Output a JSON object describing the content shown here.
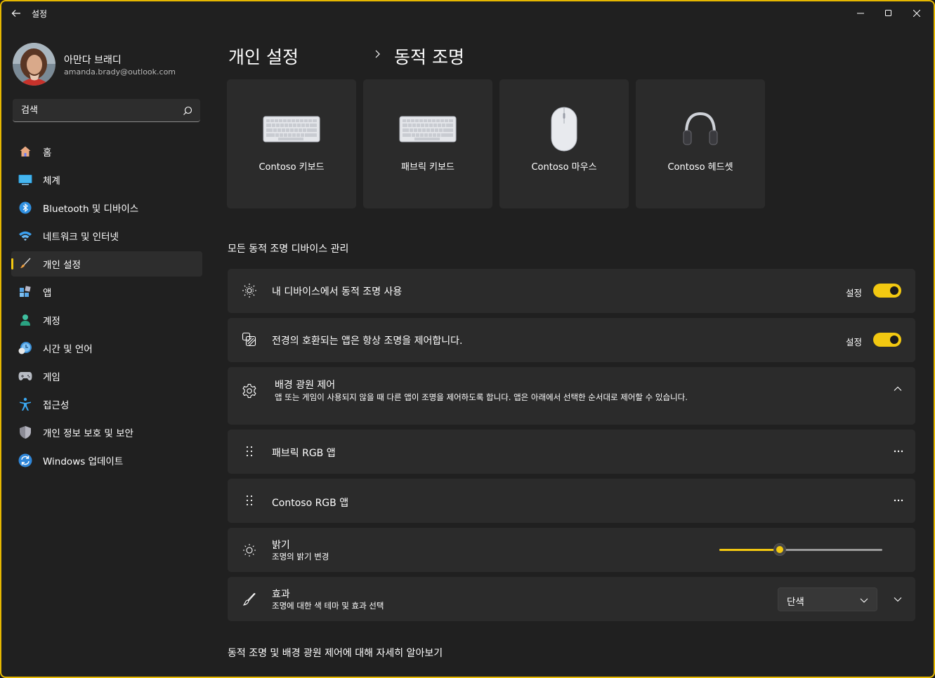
{
  "window": {
    "title": "설정",
    "border_color": "#e6b800"
  },
  "profile": {
    "name": "아만다 브래디",
    "email": "amanda.brady@outlook.com"
  },
  "search": {
    "placeholder": "검색"
  },
  "nav": {
    "items": [
      {
        "label": "홈",
        "icon": "home-icon"
      },
      {
        "label": "체계",
        "icon": "system-icon"
      },
      {
        "label": "Bluetooth 및 디바이스",
        "icon": "bluetooth-icon"
      },
      {
        "label": "네트워크 및 인터넷",
        "icon": "wifi-icon"
      },
      {
        "label": "개인 설정",
        "icon": "brush-icon",
        "active": true
      },
      {
        "label": "앱",
        "icon": "apps-icon"
      },
      {
        "label": "계정",
        "icon": "account-icon"
      },
      {
        "label": "시간 및 언어",
        "icon": "time-language-icon"
      },
      {
        "label": "게임",
        "icon": "gamepad-icon"
      },
      {
        "label": "접근성",
        "icon": "accessibility-icon"
      },
      {
        "label": "개인 정보 보호 및 보안",
        "icon": "shield-icon"
      },
      {
        "label": "Windows 업데이트",
        "icon": "update-icon"
      }
    ]
  },
  "breadcrumb": {
    "parent": "개인 설정",
    "current": "동적 조명"
  },
  "devices": [
    {
      "label": "Contoso 키보드",
      "icon": "keyboard-icon"
    },
    {
      "label": "패브릭 키보드",
      "icon": "keyboard-icon"
    },
    {
      "label": "Contoso 마우스",
      "icon": "mouse-icon"
    },
    {
      "label": "Contoso 헤드셋",
      "icon": "headset-icon"
    }
  ],
  "manage": {
    "section_title": "모든 동적 조명 디바이스 관리",
    "use_dynamic_lighting": {
      "title": "내 디바이스에서 동적 조명 사용",
      "toggle_label": "설정",
      "on": true
    },
    "foreground_control": {
      "title": "전경의 호환되는 앱은 항상 조명을 제어합니다.",
      "toggle_label": "설정",
      "on": true
    },
    "background_control": {
      "title": "배경 광원 제어",
      "subtitle": "앱 또는 게임이 사용되지 않을 때 다른 앱이 조명을 제어하도록 합니다. 앱은 아래에서 선택한 순서대로 제어할 수 있습니다.",
      "expanded": true
    },
    "apps": [
      {
        "label": "패브릭 RGB 앱"
      },
      {
        "label": "Contoso RGB 앱"
      }
    ],
    "brightness": {
      "title": "밝기",
      "subtitle": "조명의 밝기 변경",
      "value_percent": 37
    },
    "effects": {
      "title": "효과",
      "subtitle": "조명에 대한 색 테마 및 효과 선택",
      "selected": "단색"
    }
  },
  "learn_more": "동적 조명 및 배경 광원 제어에 대해 자세히 알아보기",
  "colors": {
    "accent": "#f2c811",
    "background": "#202020",
    "card": "#2b2b2b"
  }
}
